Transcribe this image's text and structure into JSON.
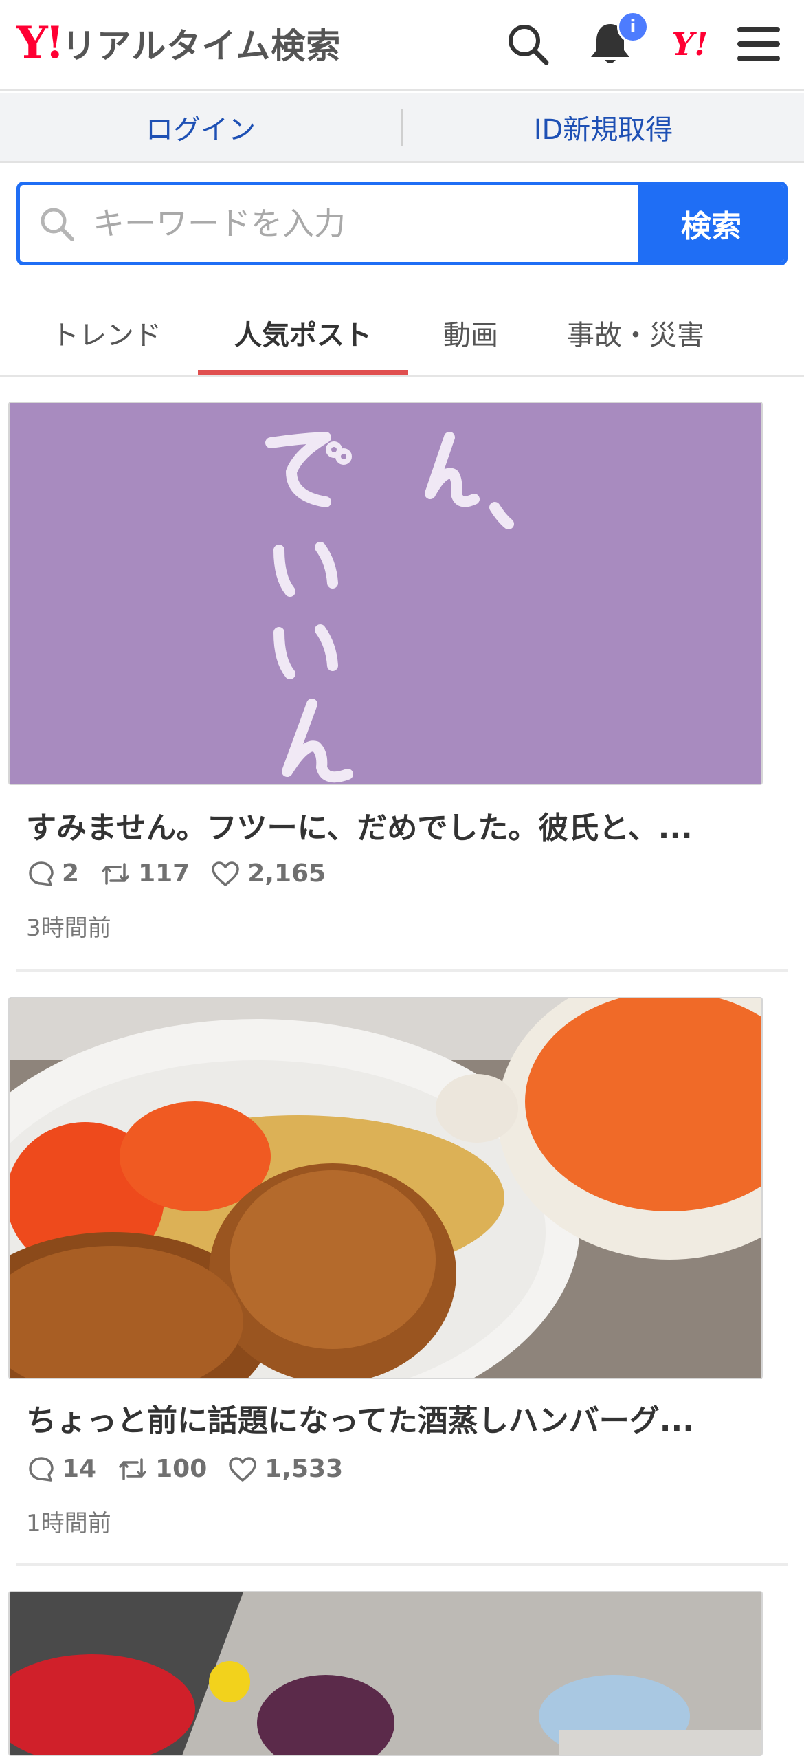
{
  "header": {
    "logo_mark": "Y!",
    "title": "リアルタイム検索",
    "notification_badge": "i",
    "yahoo_icon_text": "Y!"
  },
  "loginbar": {
    "login": "ログイン",
    "register": "ID新規取得"
  },
  "search": {
    "placeholder": "キーワードを入力",
    "value": "",
    "button": "検索"
  },
  "tabs": [
    {
      "label": "トレンド",
      "active": false
    },
    {
      "label": "人気ポスト",
      "active": true
    },
    {
      "label": "動画",
      "active": false
    },
    {
      "label": "事故・災害",
      "active": false
    }
  ],
  "posts": [
    {
      "title": "すみません。フツーに、だめでした。彼氏と、...",
      "replies": "2",
      "reposts": "117",
      "likes": "2,165",
      "time": "3時間前",
      "image_text": "ん、 でいいんだ"
    },
    {
      "title": "ちょっと前に話題になってた酒蒸しハンバーグ...",
      "replies": "14",
      "reposts": "100",
      "likes": "1,533",
      "time": "1時間前"
    },
    {}
  ],
  "colors": {
    "brand_red": "#ff0033",
    "accent_blue": "#1f6ef5",
    "link_blue": "#1e50b4",
    "tab_underline": "#e04f4f",
    "badge_blue": "#4d7cfe"
  }
}
